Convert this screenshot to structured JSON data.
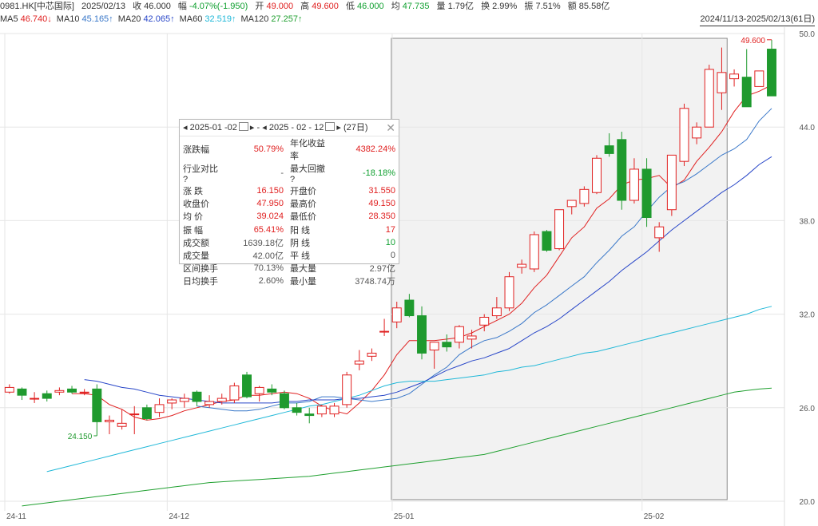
{
  "header": {
    "symbol": "0981.HK[中芯国际]",
    "date": "2025/02/13",
    "close_label": "收",
    "close": "46.000",
    "chg_label": "幅",
    "chg": "-4.07%(-1.950)",
    "open_label": "开",
    "open": "49.000",
    "high_label": "高",
    "high": "49.600",
    "low_label": "低",
    "low": "46.000",
    "avg_label": "均",
    "avg": "47.735",
    "vol_label": "量",
    "vol": "1.79亿",
    "turn_label": "换",
    "turn": "2.99%",
    "amp_label": "振",
    "amp": "7.51%",
    "amt_label": "额",
    "amt": "85.58亿"
  },
  "ma": [
    {
      "label": "MA5",
      "value": "46.740↓",
      "color": "#e02020"
    },
    {
      "label": "MA10",
      "value": "45.165↑",
      "color": "#3a78c9"
    },
    {
      "label": "MA20",
      "value": "42.065↑",
      "color": "#2846c8"
    },
    {
      "label": "MA60",
      "value": "32.519↑",
      "color": "#20b8d8"
    },
    {
      "label": "MA120",
      "value": "27.257↑",
      "color": "#20a030"
    }
  ],
  "range_label": "2024/11/13-2025/02/13(61日)",
  "stat": {
    "start": "2025-01 -02",
    "sep": "-",
    "end": "2025 - 02 - 12",
    "days": "(27日)",
    "rows": [
      {
        "k1": "涨跌幅",
        "v1": "50.79%",
        "c1": "red",
        "k2": "年化收益率",
        "v2": "4382.24%",
        "c2": "red"
      },
      {
        "k1": "行业对比 ?",
        "v1": "-",
        "c1": "gray",
        "k2": "最大回撤 ?",
        "v2": "-18.18%",
        "c2": "grn"
      },
      {
        "k1": "涨  跌",
        "v1": "16.150",
        "c1": "red",
        "k2": "开盘价",
        "v2": "31.550",
        "c2": "red"
      },
      {
        "k1": "收盘价",
        "v1": "47.950",
        "c1": "red",
        "k2": "最高价",
        "v2": "49.150",
        "c2": "red"
      },
      {
        "k1": "均  价",
        "v1": "39.024",
        "c1": "red",
        "k2": "最低价",
        "v2": "28.350",
        "c2": "red"
      },
      {
        "k1": "振  幅",
        "v1": "65.41%",
        "c1": "red",
        "k2": "阳  线",
        "v2": "17",
        "c2": "red"
      },
      {
        "k1": "成交额",
        "v1": "1639.18亿",
        "c1": "gray",
        "k2": "阴  线",
        "v2": "10",
        "c2": "grn"
      },
      {
        "k1": "成交量",
        "v1": "42.00亿",
        "c1": "gray",
        "k2": "平  线",
        "v2": "0",
        "c2": "gray"
      },
      {
        "k1": "区间换手",
        "v1": "70.13%",
        "c1": "gray",
        "k2": "最大量",
        "v2": "2.97亿",
        "c2": "gray"
      },
      {
        "k1": "日均换手",
        "v1": "2.60%",
        "c1": "gray",
        "k2": "最小量",
        "v2": "3748.74万",
        "c2": "gray"
      }
    ]
  },
  "chart_data": {
    "type": "candlestick",
    "y_ticks": [
      "50.0",
      "44.0",
      "38.0",
      "32.0",
      "26.0",
      "20.0"
    ],
    "ylim": [
      20.0,
      50.0
    ],
    "x_ticks": [
      {
        "label": "24-11",
        "index": 0
      },
      {
        "label": "24-12",
        "index": 13
      },
      {
        "label": "25-01",
        "index": 31
      },
      {
        "label": "25-02",
        "index": 51
      }
    ],
    "selection": {
      "start_index": 31,
      "end_index": 57
    },
    "max_label": "49.600",
    "min_label": "24.150",
    "ohlc": [
      [
        27.0,
        27.5,
        26.9,
        27.3
      ],
      [
        27.2,
        27.3,
        26.5,
        26.8
      ],
      [
        26.6,
        27.0,
        26.3,
        26.6
      ],
      [
        26.9,
        27.1,
        26.4,
        26.6
      ],
      [
        27.0,
        27.3,
        26.8,
        27.1
      ],
      [
        27.2,
        27.4,
        26.9,
        27.0
      ],
      [
        27.0,
        27.2,
        26.8,
        27.0
      ],
      [
        27.2,
        27.5,
        24.2,
        25.1
      ],
      [
        25.1,
        25.5,
        24.3,
        25.2
      ],
      [
        24.8,
        25.9,
        24.6,
        25.0
      ],
      [
        25.6,
        26.1,
        24.3,
        25.6
      ],
      [
        26.0,
        26.2,
        25.2,
        25.3
      ],
      [
        25.7,
        26.6,
        25.4,
        26.2
      ],
      [
        26.3,
        26.6,
        25.9,
        26.5
      ],
      [
        26.4,
        26.9,
        26.0,
        26.6
      ],
      [
        27.0,
        27.1,
        26.1,
        26.4
      ],
      [
        26.2,
        26.8,
        26.0,
        26.4
      ],
      [
        26.4,
        26.9,
        26.2,
        26.6
      ],
      [
        26.5,
        27.6,
        26.3,
        27.4
      ],
      [
        28.1,
        28.3,
        26.6,
        26.7
      ],
      [
        26.9,
        27.4,
        26.4,
        27.3
      ],
      [
        27.2,
        27.5,
        26.8,
        27.0
      ],
      [
        26.9,
        27.1,
        25.9,
        26.0
      ],
      [
        26.0,
        26.3,
        25.5,
        25.7
      ],
      [
        25.6,
        26.0,
        25.0,
        25.5
      ],
      [
        25.6,
        26.2,
        25.4,
        26.1
      ],
      [
        25.6,
        26.3,
        25.4,
        26.1
      ],
      [
        26.2,
        28.3,
        26.0,
        28.1
      ],
      [
        28.8,
        29.7,
        28.4,
        29.0
      ],
      [
        29.3,
        29.8,
        29.0,
        29.5
      ],
      [
        30.9,
        31.7,
        30.6,
        30.9
      ],
      [
        31.5,
        32.8,
        31.1,
        32.4
      ],
      [
        32.9,
        33.3,
        31.8,
        31.9
      ],
      [
        31.9,
        32.5,
        29.1,
        29.5
      ],
      [
        29.7,
        30.2,
        28.5,
        30.2
      ],
      [
        30.2,
        30.7,
        29.6,
        29.9
      ],
      [
        30.2,
        31.3,
        29.8,
        31.2
      ],
      [
        30.4,
        31.0,
        29.8,
        30.6
      ],
      [
        31.3,
        32.0,
        30.9,
        31.8
      ],
      [
        31.9,
        33.1,
        31.7,
        32.4
      ],
      [
        32.4,
        34.7,
        32.2,
        34.4
      ],
      [
        35.0,
        35.5,
        34.6,
        35.2
      ],
      [
        34.9,
        37.3,
        34.7,
        37.1
      ],
      [
        37.3,
        37.4,
        36.0,
        36.1
      ],
      [
        36.2,
        38.7,
        36.1,
        38.7
      ],
      [
        38.9,
        39.3,
        38.4,
        39.3
      ],
      [
        39.1,
        40.2,
        38.9,
        40.0
      ],
      [
        39.8,
        42.2,
        39.7,
        42.0
      ],
      [
        42.8,
        43.6,
        42.1,
        42.3
      ],
      [
        43.2,
        43.7,
        38.7,
        39.3
      ],
      [
        39.3,
        42.0,
        39.1,
        41.3
      ],
      [
        41.3,
        42.0,
        37.6,
        38.2
      ],
      [
        36.9,
        37.9,
        36.0,
        37.6
      ],
      [
        38.7,
        42.2,
        38.3,
        42.2
      ],
      [
        41.8,
        45.5,
        41.5,
        45.2
      ],
      [
        43.3,
        44.3,
        42.9,
        44.0
      ],
      [
        44.0,
        48.0,
        44.0,
        47.7
      ],
      [
        46.2,
        49.1,
        45.1,
        47.5
      ],
      [
        47.1,
        47.7,
        46.6,
        47.4
      ],
      [
        47.2,
        49.0,
        45.9,
        45.3
      ],
      [
        46.6,
        47.6,
        46.6,
        47.6
      ],
      [
        49.0,
        49.6,
        46.0,
        46.0
      ]
    ],
    "ma_series": {
      "MA5": [
        null,
        null,
        null,
        null,
        26.9,
        26.9,
        26.8,
        26.2,
        25.9,
        25.4,
        25.2,
        25.3,
        25.5,
        25.8,
        26.0,
        26.2,
        26.4,
        26.5,
        26.8,
        26.8,
        26.9,
        27.0,
        26.9,
        26.6,
        26.1,
        25.8,
        25.6,
        26.3,
        27.1,
        28.1,
        29.4,
        30.3,
        30.3,
        30.3,
        30.4,
        30.5,
        30.8,
        31.2,
        31.6,
        32.0,
        32.7,
        33.7,
        34.5,
        35.7,
        36.9,
        37.6,
        38.8,
        39.4,
        40.3,
        40.6,
        40.7,
        40.9,
        40.1,
        40.6,
        41.8,
        42.7,
        43.7,
        45.0,
        46.0,
        46.3,
        46.7
      ],
      "MA10": [
        null,
        null,
        null,
        null,
        null,
        null,
        null,
        null,
        null,
        26.1,
        26.0,
        25.9,
        25.8,
        25.8,
        25.9,
        26.1,
        26.3,
        26.3,
        26.4,
        26.7,
        26.7,
        26.6,
        26.5,
        26.4,
        26.5,
        26.6,
        26.9,
        27.5,
        28.1,
        28.6,
        29.4,
        29.9,
        30.3,
        30.5,
        30.9,
        31.4,
        32.1,
        32.6,
        33.2,
        33.8,
        34.4,
        35.3,
        36.1,
        37.0,
        37.6,
        38.6,
        39.5,
        40.2,
        40.5,
        41.0,
        41.6,
        42.2,
        42.6,
        43.2,
        44.4,
        45.2
      ],
      "MA20": [
        27.8,
        27.7,
        27.5,
        27.3,
        27.2,
        27.0,
        26.8,
        26.7,
        26.6,
        26.5,
        26.4,
        26.3,
        26.3,
        26.3,
        26.3,
        26.3,
        26.4,
        26.4,
        26.5,
        26.5,
        26.5,
        26.6,
        26.6,
        26.7,
        26.8,
        27.0,
        27.3,
        27.6,
        28.0,
        28.4,
        28.7,
        29.0,
        29.2,
        29.5,
        29.8,
        30.3,
        30.8,
        31.2,
        31.7,
        32.3,
        32.9,
        33.5,
        34.1,
        34.8,
        35.4,
        36.0,
        36.7,
        37.4,
        38.0,
        38.6,
        39.2,
        39.8,
        40.3,
        40.9,
        41.6,
        42.1
      ],
      "MA60": [
        21.9,
        22.1,
        22.3,
        22.5,
        22.7,
        22.9,
        23.1,
        23.3,
        23.5,
        23.7,
        23.9,
        24.1,
        24.3,
        24.5,
        24.7,
        24.9,
        25.1,
        25.3,
        25.5,
        25.7,
        25.9,
        26.1,
        26.2,
        26.4,
        26.6,
        26.8,
        27.1,
        27.4,
        27.6,
        27.7,
        27.7,
        27.7,
        27.8,
        27.9,
        28.0,
        28.1,
        28.3,
        28.4,
        28.6,
        28.7,
        28.9,
        29.1,
        29.3,
        29.5,
        29.6,
        29.8,
        30.0,
        30.2,
        30.4,
        30.6,
        30.8,
        31.0,
        31.2,
        31.4,
        31.6,
        31.8,
        32.0,
        32.3,
        32.5
      ],
      "MA120": [
        19.7,
        19.8,
        19.9,
        20.0,
        20.1,
        20.2,
        20.3,
        20.4,
        20.5,
        20.6,
        20.7,
        20.8,
        20.9,
        21.0,
        21.1,
        21.2,
        21.25,
        21.3,
        21.35,
        21.4,
        21.45,
        21.5,
        21.55,
        21.6,
        21.7,
        21.8,
        21.9,
        22.0,
        22.1,
        22.2,
        22.3,
        22.4,
        22.5,
        22.6,
        22.7,
        22.8,
        22.9,
        23.0,
        23.2,
        23.4,
        23.6,
        23.8,
        24.0,
        24.2,
        24.4,
        24.6,
        24.8,
        25.0,
        25.2,
        25.4,
        25.6,
        25.8,
        26.0,
        26.2,
        26.4,
        26.6,
        26.8,
        27.0,
        27.1,
        27.2,
        27.26
      ]
    },
    "colors": {
      "up": "#e02020",
      "down": "#1f9a2e",
      "grid": "#e6e6e6",
      "selection": "#f2f2f2"
    }
  }
}
